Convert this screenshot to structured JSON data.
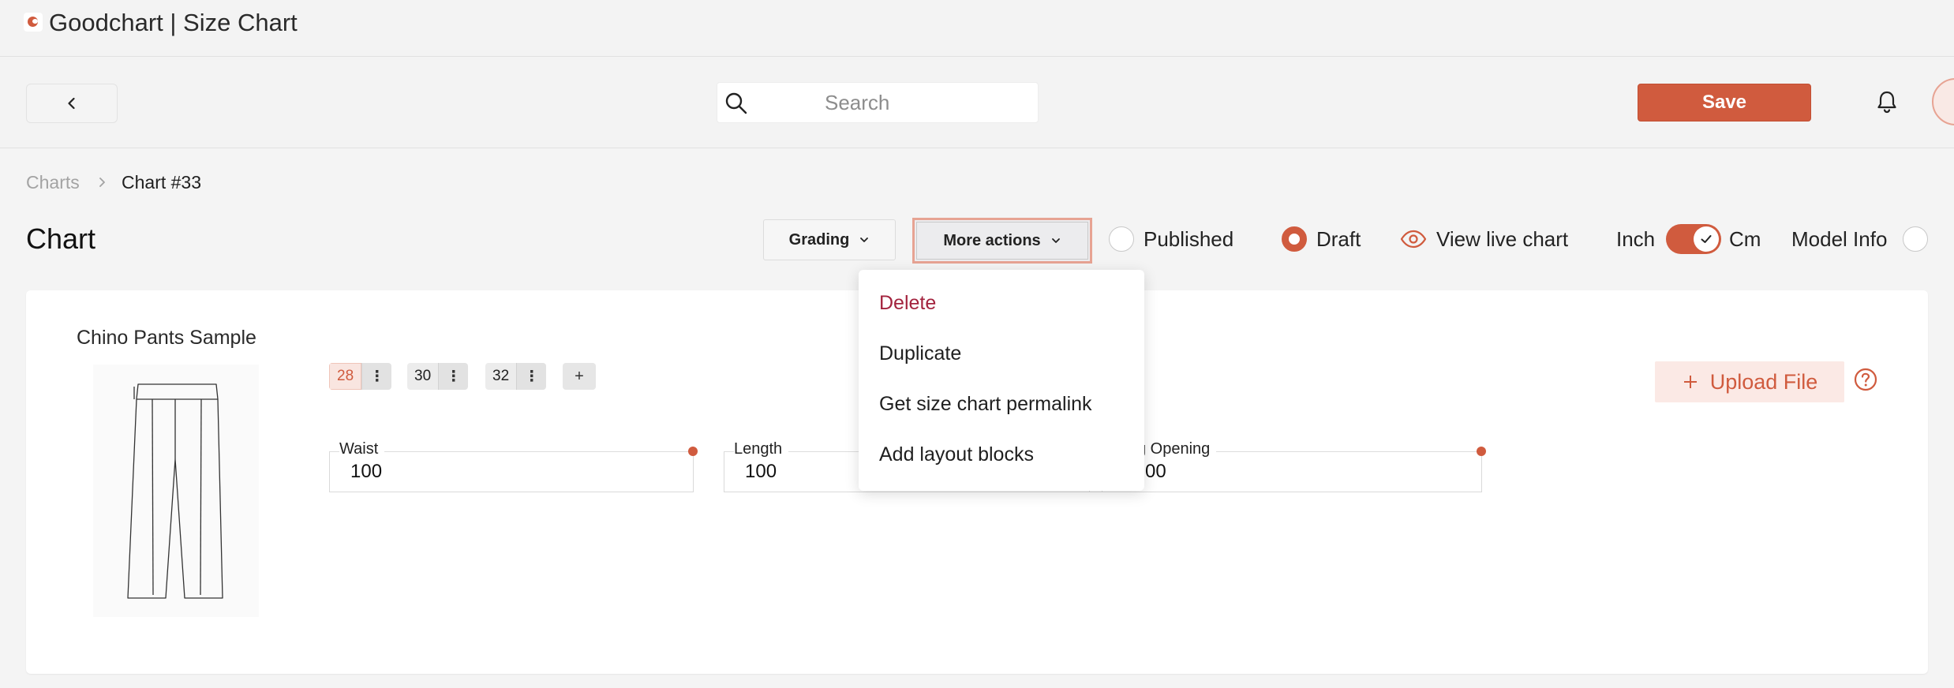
{
  "window": {
    "title": "Goodchart | Size Chart"
  },
  "toolbar": {
    "search_placeholder": "Search",
    "save_label": "Save"
  },
  "breadcrumb": {
    "root": "Charts",
    "current": "Chart #33"
  },
  "header": {
    "title": "Chart",
    "grading_label": "Grading",
    "more_actions_label": "More actions",
    "status_options": [
      {
        "label": "Published",
        "selected": false
      },
      {
        "label": "Draft",
        "selected": true
      }
    ],
    "view_live_label": "View live chart",
    "unit_left": "Inch",
    "unit_right": "Cm",
    "unit_toggle_on": true,
    "model_info_label": "Model Info"
  },
  "product": {
    "name": "Chino Pants Sample",
    "sizes": [
      {
        "label": "28",
        "active": true
      },
      {
        "label": "30",
        "active": false
      },
      {
        "label": "32",
        "active": false
      }
    ],
    "add_size_label": "+",
    "size_menu_glyph": "⋮",
    "measurements": [
      {
        "label": "Waist",
        "value": "100"
      },
      {
        "label": "Length",
        "value": "100"
      },
      {
        "label": "g Opening",
        "value": "00"
      }
    ],
    "upload_label": "Upload File"
  },
  "more_actions_menu": {
    "items": [
      "Delete",
      "Duplicate",
      "Get size chart permalink",
      "Add layout blocks"
    ]
  },
  "colors": {
    "accent": "#d05b3e",
    "danger_text": "#a3233e"
  }
}
